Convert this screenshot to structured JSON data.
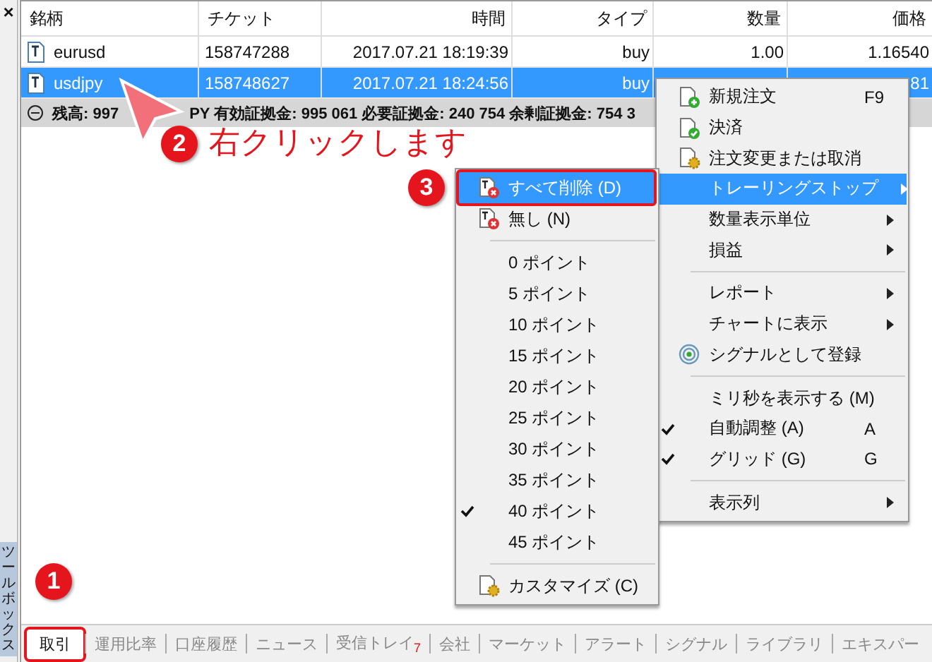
{
  "toolbox": {
    "close": "×",
    "title": "ツールボックス"
  },
  "table": {
    "columns": [
      "銘柄",
      "チケット",
      "時間",
      "タイプ",
      "数量",
      "価格"
    ],
    "rows": [
      {
        "selected": false,
        "cells": [
          "eurusd",
          "158747288",
          "2017.07.21 18:19:39",
          "buy",
          "1.00",
          "1.16540"
        ]
      },
      {
        "selected": true,
        "cells": [
          "usdjpy",
          "158748627",
          "2017.07.21 18:24:56",
          "buy",
          "",
          "81"
        ]
      }
    ],
    "summary": [
      "残高: 997",
      "PY 有効証拠金: 995 061 必要証拠金: 240 754 余剰証拠金: 754 3"
    ]
  },
  "context_menu": [
    {
      "kind": "doc-plus",
      "label": "新規注文",
      "shortcut": "F9",
      "submenu": false,
      "checked": false,
      "selected": false
    },
    {
      "kind": "doc-check",
      "label": "決済",
      "submenu": false,
      "checked": false,
      "selected": false
    },
    {
      "kind": "doc-gear",
      "label": "注文変更または取消",
      "submenu": false,
      "checked": false,
      "selected": false
    },
    {
      "kind": "text",
      "label": "トレーリングストップ",
      "submenu": true,
      "checked": false,
      "selected": true
    },
    {
      "kind": "text",
      "label": "数量表示単位",
      "submenu": true,
      "checked": false,
      "selected": false
    },
    {
      "kind": "text",
      "label": "損益",
      "submenu": true,
      "checked": false,
      "selected": false
    },
    {
      "kind": "separator"
    },
    {
      "kind": "text",
      "label": "レポート",
      "submenu": true,
      "checked": false,
      "selected": false
    },
    {
      "kind": "text",
      "label": "チャートに表示",
      "submenu": true,
      "checked": false,
      "selected": false
    },
    {
      "kind": "signal",
      "label": "シグナルとして登録",
      "submenu": false,
      "checked": false,
      "selected": false
    },
    {
      "kind": "separator"
    },
    {
      "kind": "text",
      "label": "ミリ秒を表示する (M)",
      "submenu": false,
      "checked": false,
      "selected": false
    },
    {
      "kind": "text",
      "label": "自動調整 (A)",
      "shortcut": "A",
      "submenu": false,
      "checked": true,
      "selected": false
    },
    {
      "kind": "text",
      "label": "グリッド (G)",
      "shortcut": "G",
      "submenu": false,
      "checked": true,
      "selected": false
    },
    {
      "kind": "separator"
    },
    {
      "kind": "text",
      "label": "表示列",
      "submenu": true,
      "checked": false,
      "selected": false
    }
  ],
  "submenu": [
    {
      "kind": "doc-delete",
      "label": "すべて削除 (D)",
      "checked": false,
      "selected": true
    },
    {
      "kind": "doc-delete",
      "label": "無し (N)",
      "checked": false,
      "selected": false
    },
    {
      "kind": "separator"
    },
    {
      "kind": "text",
      "label": "0 ポイント",
      "checked": false,
      "selected": false
    },
    {
      "kind": "text",
      "label": "5 ポイント",
      "checked": false,
      "selected": false
    },
    {
      "kind": "text",
      "label": "10 ポイント",
      "checked": false,
      "selected": false
    },
    {
      "kind": "text",
      "label": "15 ポイント",
      "checked": false,
      "selected": false
    },
    {
      "kind": "text",
      "label": "20 ポイント",
      "checked": false,
      "selected": false
    },
    {
      "kind": "text",
      "label": "25 ポイント",
      "checked": false,
      "selected": false
    },
    {
      "kind": "text",
      "label": "30 ポイント",
      "checked": false,
      "selected": false
    },
    {
      "kind": "text",
      "label": "35 ポイント",
      "checked": false,
      "selected": false
    },
    {
      "kind": "text",
      "label": "40 ポイント",
      "checked": true,
      "selected": false
    },
    {
      "kind": "text",
      "label": "45 ポイント",
      "checked": false,
      "selected": false
    },
    {
      "kind": "separator"
    },
    {
      "kind": "doc-gear",
      "label": "カスタマイズ (C)",
      "checked": false,
      "selected": false
    }
  ],
  "tabs": [
    {
      "label": "取引",
      "selected": true
    },
    {
      "label": "運用比率",
      "selected": false
    },
    {
      "label": "口座履歴",
      "selected": false
    },
    {
      "label": "ニュース",
      "selected": false
    },
    {
      "label": "受信トレイ",
      "badge": "7",
      "selected": false
    },
    {
      "label": "会社",
      "selected": false
    },
    {
      "label": "マーケット",
      "selected": false
    },
    {
      "label": "アラート",
      "selected": false
    },
    {
      "label": "シグナル",
      "selected": false
    },
    {
      "label": "ライブラリ",
      "selected": false
    },
    {
      "label": "エキスパー",
      "selected": false
    }
  ],
  "annotations": [
    {
      "number": "1"
    },
    {
      "number": "2",
      "text": "右クリックします"
    },
    {
      "number": "3"
    }
  ]
}
